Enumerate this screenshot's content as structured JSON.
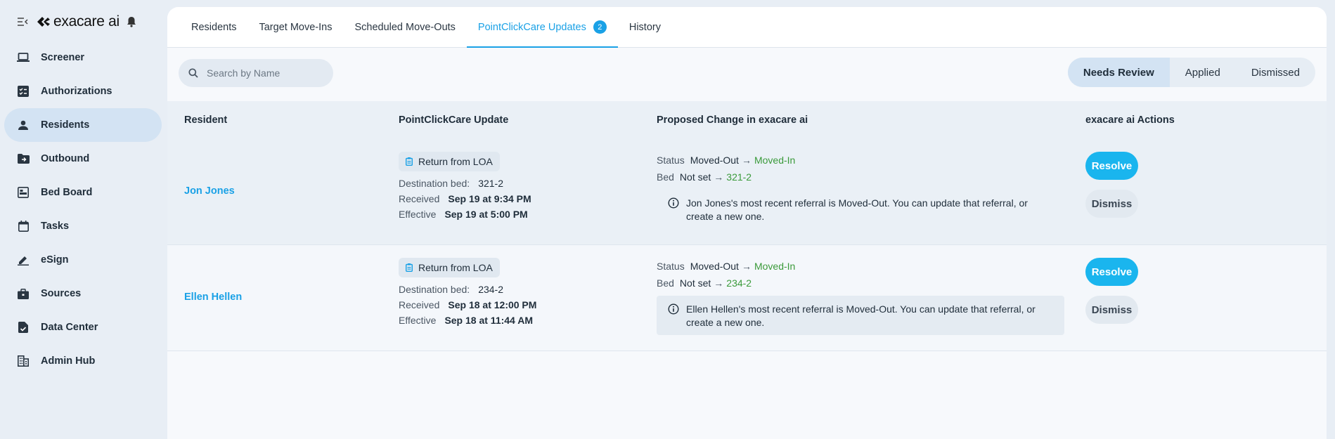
{
  "brand": {
    "name": "exacare ai"
  },
  "sidebar": {
    "items": [
      {
        "label": "Screener",
        "icon": "laptop-icon"
      },
      {
        "label": "Authorizations",
        "icon": "checklist-icon"
      },
      {
        "label": "Residents",
        "icon": "person-icon",
        "active": true
      },
      {
        "label": "Outbound",
        "icon": "folder-arrow-icon"
      },
      {
        "label": "Bed Board",
        "icon": "bed-board-icon"
      },
      {
        "label": "Tasks",
        "icon": "calendar-icon"
      },
      {
        "label": "eSign",
        "icon": "pen-icon"
      },
      {
        "label": "Sources",
        "icon": "briefcase-icon"
      },
      {
        "label": "Data Center",
        "icon": "document-check-icon"
      },
      {
        "label": "Admin Hub",
        "icon": "building-icon"
      }
    ]
  },
  "tabs": [
    {
      "label": "Residents"
    },
    {
      "label": "Target Move-Ins"
    },
    {
      "label": "Scheduled Move-Outs"
    },
    {
      "label": "PointClickCare Updates",
      "badge": "2",
      "active": true
    },
    {
      "label": "History"
    }
  ],
  "search": {
    "placeholder": "Search by Name",
    "value": ""
  },
  "filter": {
    "options": [
      "Needs Review",
      "Applied",
      "Dismissed"
    ],
    "selected": "Needs Review"
  },
  "table": {
    "headers": {
      "resident": "Resident",
      "update": "PointClickCare Update",
      "change": "Proposed Change in exacare ai",
      "actions": "exacare ai Actions"
    },
    "rows": [
      {
        "resident": "Jon Jones",
        "event": "Return from LOA",
        "dest_label": "Destination bed:",
        "dest": "321-2",
        "received_label": "Received",
        "received": "Sep 19 at 9:34 PM",
        "effective_label": "Effective",
        "effective": "Sep 19 at 5:00 PM",
        "status_label": "Status",
        "status_from": "Moved-Out",
        "status_to": "Moved-In",
        "bed_label": "Bed",
        "bed_from": "Not set",
        "bed_to": "321-2",
        "note": "Jon Jones's most recent referral is Moved-Out. You can update that referral, or create a new one.",
        "resolve": "Resolve",
        "dismiss": "Dismiss"
      },
      {
        "resident": "Ellen Hellen",
        "event": "Return from LOA",
        "dest_label": "Destination bed:",
        "dest": "234-2",
        "received_label": "Received",
        "received": "Sep 18 at 12:00 PM",
        "effective_label": "Effective",
        "effective": "Sep 18 at 11:44 AM",
        "status_label": "Status",
        "status_from": "Moved-Out",
        "status_to": "Moved-In",
        "bed_label": "Bed",
        "bed_from": "Not set",
        "bed_to": "234-2",
        "note": "Ellen Hellen's most recent referral is Moved-Out. You can update that referral, or create a new one.",
        "resolve": "Resolve",
        "dismiss": "Dismiss"
      }
    ]
  },
  "colors": {
    "accent": "#1aa1e6",
    "success": "#3a9a3a",
    "active_bg": "#d3e3f3"
  }
}
